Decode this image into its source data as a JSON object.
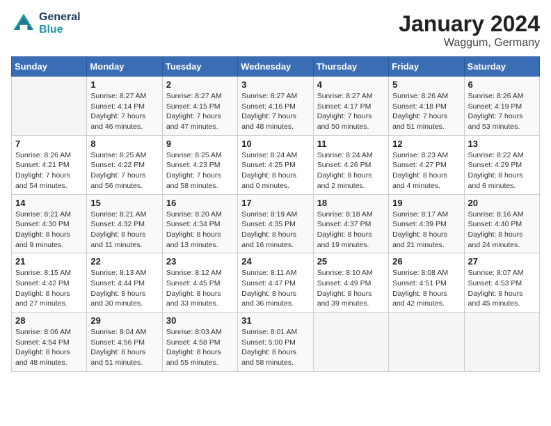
{
  "header": {
    "logo_line1": "General",
    "logo_line2": "Blue",
    "title": "January 2024",
    "location": "Waggum, Germany"
  },
  "weekdays": [
    "Sunday",
    "Monday",
    "Tuesday",
    "Wednesday",
    "Thursday",
    "Friday",
    "Saturday"
  ],
  "weeks": [
    [
      {
        "day": "",
        "info": ""
      },
      {
        "day": "1",
        "info": "Sunrise: 8:27 AM\nSunset: 4:14 PM\nDaylight: 7 hours\nand 46 minutes."
      },
      {
        "day": "2",
        "info": "Sunrise: 8:27 AM\nSunset: 4:15 PM\nDaylight: 7 hours\nand 47 minutes."
      },
      {
        "day": "3",
        "info": "Sunrise: 8:27 AM\nSunset: 4:16 PM\nDaylight: 7 hours\nand 48 minutes."
      },
      {
        "day": "4",
        "info": "Sunrise: 8:27 AM\nSunset: 4:17 PM\nDaylight: 7 hours\nand 50 minutes."
      },
      {
        "day": "5",
        "info": "Sunrise: 8:26 AM\nSunset: 4:18 PM\nDaylight: 7 hours\nand 51 minutes."
      },
      {
        "day": "6",
        "info": "Sunrise: 8:26 AM\nSunset: 4:19 PM\nDaylight: 7 hours\nand 53 minutes."
      }
    ],
    [
      {
        "day": "7",
        "info": "Sunrise: 8:26 AM\nSunset: 4:21 PM\nDaylight: 7 hours\nand 54 minutes."
      },
      {
        "day": "8",
        "info": "Sunrise: 8:25 AM\nSunset: 4:22 PM\nDaylight: 7 hours\nand 56 minutes."
      },
      {
        "day": "9",
        "info": "Sunrise: 8:25 AM\nSunset: 4:23 PM\nDaylight: 7 hours\nand 58 minutes."
      },
      {
        "day": "10",
        "info": "Sunrise: 8:24 AM\nSunset: 4:25 PM\nDaylight: 8 hours\nand 0 minutes."
      },
      {
        "day": "11",
        "info": "Sunrise: 8:24 AM\nSunset: 4:26 PM\nDaylight: 8 hours\nand 2 minutes."
      },
      {
        "day": "12",
        "info": "Sunrise: 8:23 AM\nSunset: 4:27 PM\nDaylight: 8 hours\nand 4 minutes."
      },
      {
        "day": "13",
        "info": "Sunrise: 8:22 AM\nSunset: 4:29 PM\nDaylight: 8 hours\nand 6 minutes."
      }
    ],
    [
      {
        "day": "14",
        "info": "Sunrise: 8:21 AM\nSunset: 4:30 PM\nDaylight: 8 hours\nand 9 minutes."
      },
      {
        "day": "15",
        "info": "Sunrise: 8:21 AM\nSunset: 4:32 PM\nDaylight: 8 hours\nand 11 minutes."
      },
      {
        "day": "16",
        "info": "Sunrise: 8:20 AM\nSunset: 4:34 PM\nDaylight: 8 hours\nand 13 minutes."
      },
      {
        "day": "17",
        "info": "Sunrise: 8:19 AM\nSunset: 4:35 PM\nDaylight: 8 hours\nand 16 minutes."
      },
      {
        "day": "18",
        "info": "Sunrise: 8:18 AM\nSunset: 4:37 PM\nDaylight: 8 hours\nand 19 minutes."
      },
      {
        "day": "19",
        "info": "Sunrise: 8:17 AM\nSunset: 4:39 PM\nDaylight: 8 hours\nand 21 minutes."
      },
      {
        "day": "20",
        "info": "Sunrise: 8:16 AM\nSunset: 4:40 PM\nDaylight: 8 hours\nand 24 minutes."
      }
    ],
    [
      {
        "day": "21",
        "info": "Sunrise: 8:15 AM\nSunset: 4:42 PM\nDaylight: 8 hours\nand 27 minutes."
      },
      {
        "day": "22",
        "info": "Sunrise: 8:13 AM\nSunset: 4:44 PM\nDaylight: 8 hours\nand 30 minutes."
      },
      {
        "day": "23",
        "info": "Sunrise: 8:12 AM\nSunset: 4:45 PM\nDaylight: 8 hours\nand 33 minutes."
      },
      {
        "day": "24",
        "info": "Sunrise: 8:11 AM\nSunset: 4:47 PM\nDaylight: 8 hours\nand 36 minutes."
      },
      {
        "day": "25",
        "info": "Sunrise: 8:10 AM\nSunset: 4:49 PM\nDaylight: 8 hours\nand 39 minutes."
      },
      {
        "day": "26",
        "info": "Sunrise: 8:08 AM\nSunset: 4:51 PM\nDaylight: 8 hours\nand 42 minutes."
      },
      {
        "day": "27",
        "info": "Sunrise: 8:07 AM\nSunset: 4:53 PM\nDaylight: 8 hours\nand 45 minutes."
      }
    ],
    [
      {
        "day": "28",
        "info": "Sunrise: 8:06 AM\nSunset: 4:54 PM\nDaylight: 8 hours\nand 48 minutes."
      },
      {
        "day": "29",
        "info": "Sunrise: 8:04 AM\nSunset: 4:56 PM\nDaylight: 8 hours\nand 51 minutes."
      },
      {
        "day": "30",
        "info": "Sunrise: 8:03 AM\nSunset: 4:58 PM\nDaylight: 8 hours\nand 55 minutes."
      },
      {
        "day": "31",
        "info": "Sunrise: 8:01 AM\nSunset: 5:00 PM\nDaylight: 8 hours\nand 58 minutes."
      },
      {
        "day": "",
        "info": ""
      },
      {
        "day": "",
        "info": ""
      },
      {
        "day": "",
        "info": ""
      }
    ]
  ]
}
